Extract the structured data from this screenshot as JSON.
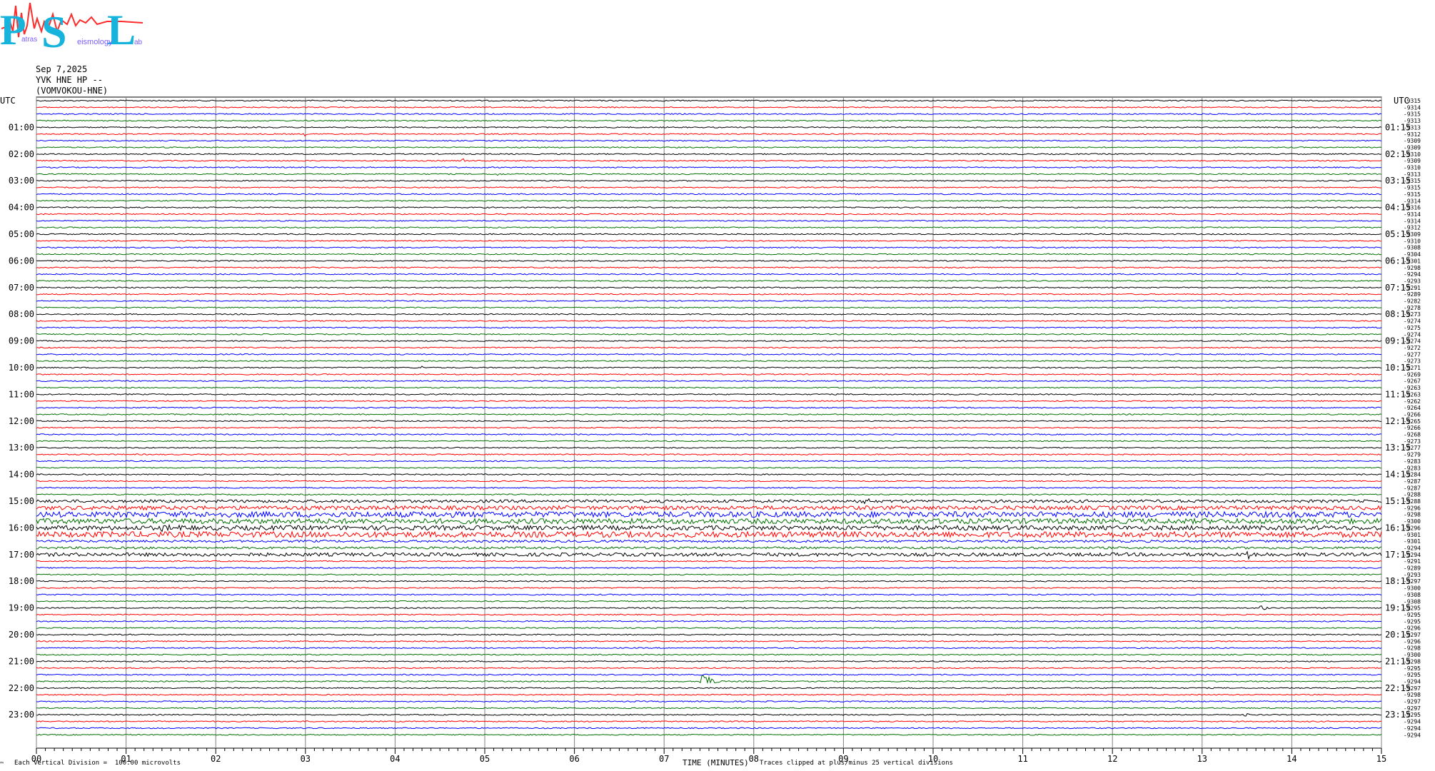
{
  "header": {
    "date": "Sep 7,2025",
    "station": "YVK HNE HP --",
    "site": "(VOMVOKOU-HNE)"
  },
  "logo": {
    "letters": [
      "P",
      "S",
      "L"
    ],
    "subtext": [
      "atras",
      "eismology",
      "ab"
    ],
    "colors": {
      "letter": "#16b4dc",
      "wave": "#ff2a2a"
    }
  },
  "colors": {
    "trace_cycle": [
      "#000000",
      "#ff0000",
      "#0000ff",
      "#007000"
    ],
    "grid": "#808080"
  },
  "footer": {
    "vertical_division": "Each Vertical Division =  100.00 microvolts",
    "xlabel": "TIME (MINUTES)",
    "clip_note": "Traces clipped at plus/minus 25 vertical divisions",
    "corner_mark": "™"
  },
  "chart_data": {
    "type": "line",
    "title": "",
    "xlabel": "TIME (MINUTES)",
    "ylabel": "UTC",
    "xlim": [
      0,
      15
    ],
    "x_ticks": [
      "00",
      "01",
      "02",
      "03",
      "04",
      "05",
      "06",
      "07",
      "08",
      "09",
      "10",
      "11",
      "12",
      "13",
      "14",
      "15"
    ],
    "left_axis_label": "UTC",
    "right_axis_label": "UTC",
    "left_hour_labels": [
      "01:00",
      "02:00",
      "03:00",
      "04:00",
      "05:00",
      "06:00",
      "07:00",
      "08:00",
      "09:00",
      "10:00",
      "11:00",
      "12:00",
      "13:00",
      "14:00",
      "15:00",
      "16:00",
      "17:00",
      "18:00",
      "19:00",
      "20:00",
      "21:00",
      "22:00",
      "23:00"
    ],
    "right_hour_labels": [
      "01:15",
      "02:15",
      "03:15",
      "04:15",
      "05:15",
      "06:15",
      "07:15",
      "08:15",
      "09:15",
      "10:15",
      "11:15",
      "12:15",
      "13:15",
      "14:15",
      "15:15",
      "16:15",
      "17:15",
      "18:15",
      "19:15",
      "20:15",
      "21:15",
      "22:15",
      "23:15"
    ],
    "trace_count": 96,
    "trace_values": [
      "-9315",
      "-9314",
      "-9315",
      "-9313",
      "-9313",
      "-9312",
      "-9309",
      "-9309",
      "-9310",
      "-9309",
      "-9310",
      "-9313",
      "-9315",
      "-9315",
      "-9315",
      "-9314",
      "-9316",
      "-9314",
      "-9314",
      "-9312",
      "-9309",
      "-9310",
      "-9308",
      "-9304",
      "-9301",
      "-9298",
      "-9294",
      "-9293",
      "-9291",
      "-9289",
      "-9282",
      "-9278",
      "-9273",
      "-9274",
      "-9275",
      "-9274",
      "-9274",
      "-9272",
      "-9277",
      "-9273",
      "-9271",
      "-9269",
      "-9267",
      "-9263",
      "-9263",
      "-9262",
      "-9264",
      "-9266",
      "-9265",
      "-9266",
      "-9268",
      "-9273",
      "-9277",
      "-9279",
      "-9283",
      "-9283",
      "-9284",
      "-9287",
      "-9287",
      "-9288",
      "-9288",
      "-9296",
      "-9298",
      "-9300",
      "-9296",
      "-9301",
      "-9301",
      "-9294",
      "-9294",
      "-9291",
      "-9289",
      "-9293",
      "-9297",
      "-9300",
      "-9308",
      "-9308",
      "-9295",
      "-9295",
      "-9295",
      "-9296",
      "-9297",
      "-9296",
      "-9298",
      "-9300",
      "-9298",
      "-9295",
      "-9295",
      "-9294",
      "-9297",
      "-9298",
      "-9297",
      "-9297",
      "-9295",
      "-9294",
      "-9294",
      "-9294"
    ],
    "noise_levels": [
      1,
      1,
      1,
      1,
      1,
      1,
      1,
      1,
      1,
      1,
      1,
      1,
      1,
      1,
      1,
      1,
      1,
      1,
      1,
      1,
      1,
      1,
      1,
      1,
      1,
      1,
      1,
      1,
      1,
      1,
      1,
      1,
      1,
      1,
      1,
      1,
      1,
      1,
      1,
      1,
      1,
      1,
      1,
      1,
      1,
      1,
      1,
      1,
      1,
      1,
      1,
      1,
      1,
      1,
      1,
      1,
      1,
      1,
      1,
      1,
      2.5,
      3.5,
      5,
      4.5,
      4,
      5,
      2,
      2,
      3,
      1,
      1,
      1,
      1,
      1,
      1,
      1,
      1,
      1,
      1,
      1,
      1,
      1,
      1,
      1,
      1,
      1,
      1,
      1,
      1,
      1,
      1,
      1,
      1,
      1,
      1,
      1
    ],
    "events": [
      {
        "trace": 60,
        "minute": 9.2,
        "amplitude_div": 14,
        "duration_min": 0.12
      },
      {
        "trace": 68,
        "minute": 13.5,
        "amplitude_div": 9,
        "duration_min": 0.2
      },
      {
        "trace": 76,
        "minute": 13.65,
        "amplitude_div": 6,
        "duration_min": 0.2
      },
      {
        "trace": 87,
        "minute": 7.4,
        "amplitude_div": 22,
        "duration_min": 0.25
      },
      {
        "trace": 92,
        "minute": 13.45,
        "amplitude_div": 6,
        "duration_min": 0.15
      },
      {
        "trace": 5,
        "minute": 3.0,
        "amplitude_div": 2.5,
        "duration_min": 0.05
      },
      {
        "trace": 11,
        "minute": 5.15,
        "amplitude_div": 2,
        "duration_min": 0.05
      },
      {
        "trace": 9,
        "minute": 4.75,
        "amplitude_div": 3,
        "duration_min": 0.12
      },
      {
        "trace": 40,
        "minute": 4.3,
        "amplitude_div": 2.5,
        "duration_min": 0.05
      },
      {
        "trace": 26,
        "minute": 13.4,
        "amplitude_div": 3,
        "duration_min": 0.05
      },
      {
        "trace": 62,
        "minute": 0.45,
        "amplitude_div": 4,
        "duration_min": 0.4
      },
      {
        "trace": 64,
        "minute": 1.4,
        "amplitude_div": 3,
        "duration_min": 0.5
      }
    ]
  }
}
